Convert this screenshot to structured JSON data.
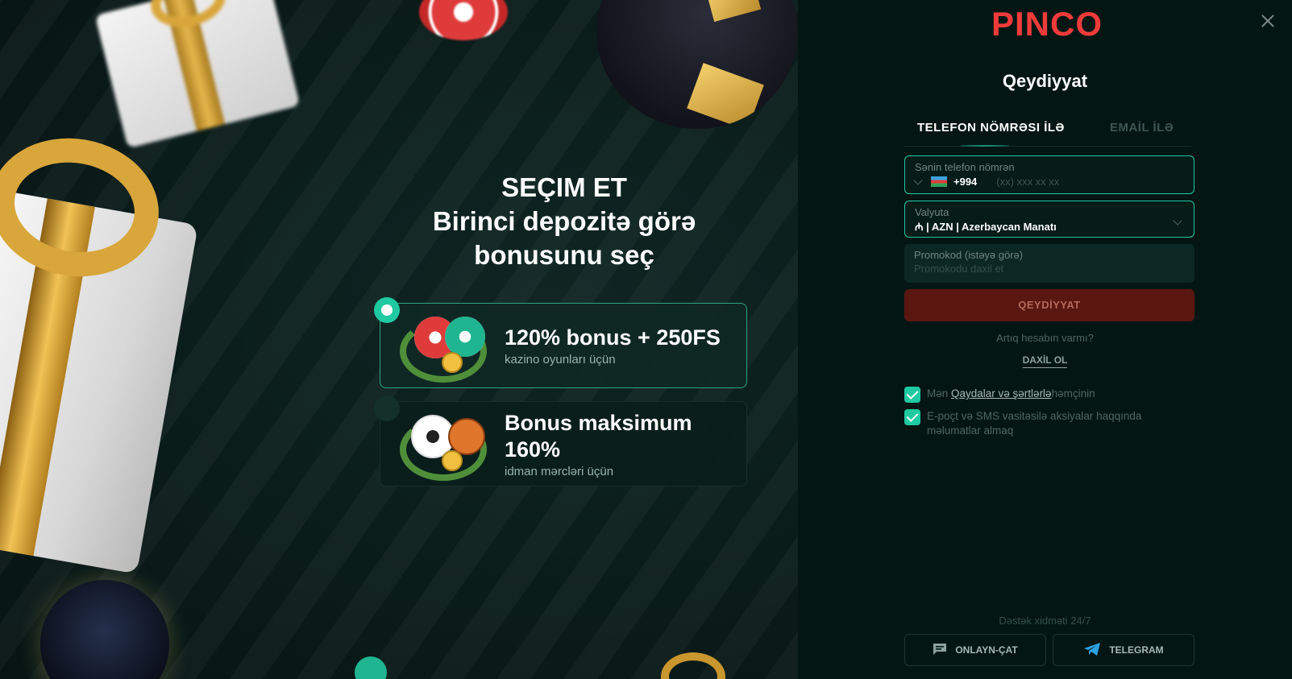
{
  "promo": {
    "heading_line1": "SEÇIM ET",
    "heading_line2": "Birinci depozitə görə",
    "heading_line3": "bonusunu seç",
    "bonuses": [
      {
        "title": "120% bonus + 250FS",
        "subtitle": "kazino oyunları üçün",
        "selected": true
      },
      {
        "title": "Bonus maksimum 160%",
        "subtitle": "idman mərcləri üçün",
        "selected": false
      }
    ]
  },
  "panel": {
    "logo": "PINCO",
    "title": "Qeydiyyat",
    "tabs": [
      "TELEFON NÖMRƏSI İLƏ",
      "EMAİL İLƏ"
    ],
    "phone": {
      "label": "Sənin telefon nömrən",
      "code": "+994",
      "placeholder": "(xx) xxx xx xx"
    },
    "currency": {
      "label": "Valyuta",
      "value": "₼ | AZN | Azerbaycan Manatı"
    },
    "promo": {
      "label": "Promokod (istəyə görə)",
      "placeholder": "Promokodu daxil et"
    },
    "submit": "QEYDİYYAT",
    "have_account": "Artıq hesabın varmı?",
    "login": "DAXİL OL",
    "consent1_prefix": "Mən ",
    "consent1_link": "Qaydalar və şərtlərlə",
    "consent1_suffix": "həmçinin",
    "consent2": "E-poçt və SMS vasitəsilə aksiyalar haqqında məlumatlar almaq",
    "support": "Dəstək xidməti 24/7",
    "chat_button": "ONLAYN-ÇAT",
    "telegram_button": "TELEGRAM"
  },
  "colors": {
    "accent": "#1fcaa1",
    "brand": "#f03b3b",
    "background": "#041614"
  },
  "icons": [
    "close-icon",
    "chat-icon",
    "telegram-icon",
    "chevron-down-icon",
    "az-flag-icon"
  ]
}
